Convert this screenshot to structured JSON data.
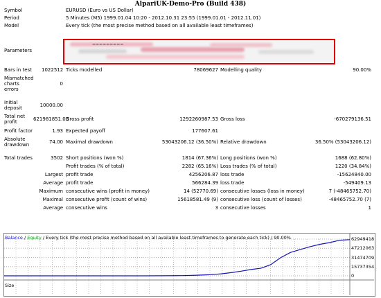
{
  "window": {
    "title": "AlpariUK-Demo-Pro (Build 438)"
  },
  "report": {
    "symbol": {
      "label": "Symbol",
      "value": "EURUSD (Euro vs US Dollar)"
    },
    "period": {
      "label": "Period",
      "value": "5 Minutes (M5) 1999.01.04 10:20 - 2012.10.31 23:55 (1999.01.01 - 2012.11.01)"
    },
    "model": {
      "label": "Model",
      "value": "Every tick (the most precise method based on all available least timeframes)"
    },
    "parameters": {
      "label": "Parameters",
      "fragment": "========="
    },
    "bars": {
      "label": "Bars in test",
      "value": "1022512"
    },
    "ticks": {
      "label": "Ticks modelled",
      "value": "78069627"
    },
    "quality": {
      "label": "Modelling quality",
      "value": "90.00%"
    },
    "mismatched": {
      "label": [
        "Mismatched",
        "charts",
        "errors"
      ],
      "value": "0"
    },
    "deposit": {
      "label": [
        "Initial",
        "deposit"
      ],
      "value": "10000.00"
    },
    "net_profit": {
      "label": [
        "Total net",
        "profit"
      ],
      "value": "621981851.03"
    },
    "gross_profit": {
      "label": "Gross profit",
      "value": "1292260987.53"
    },
    "gross_loss": {
      "label": "Gross loss",
      "value": "-670279136.51"
    },
    "profit_factor": {
      "label": "Profit factor",
      "value": "1.93"
    },
    "expected_payoff": {
      "label": "Expected payoff",
      "value": "177607.61"
    },
    "abs_drawdown": {
      "label": [
        "Absolute",
        "drawdown"
      ],
      "value": "74.00"
    },
    "max_drawdown": {
      "label": "Maximal drawdown",
      "value": "53043206.12 (36.50%)"
    },
    "rel_drawdown": {
      "label": "Relative drawdown",
      "value": "36.50% (53043206.12)"
    },
    "total_trades": {
      "label": "Total trades",
      "value": "3502"
    },
    "short_positions": {
      "label": "Short positions (won %)",
      "value": "1814 (67.36%)"
    },
    "long_positions": {
      "label": "Long positions (won %)",
      "value": "1688 (62.80%)"
    },
    "profit_trades": {
      "label": "Profit trades (% of total)",
      "value": "2282 (65.16%)"
    },
    "loss_trades": {
      "label": "Loss trades (% of total)",
      "value": "1220 (34.84%)"
    },
    "largest": {
      "prefix": "Largest",
      "profit_label": "profit trade",
      "profit_value": "4256206.87",
      "loss_label": "loss trade",
      "loss_value": "-15624840.00"
    },
    "average": {
      "prefix": "Average",
      "profit_label": "profit trade",
      "profit_value": "566284.39",
      "loss_label": "loss trade",
      "loss_value": "-549409.13"
    },
    "maximum": {
      "prefix": "Maximum",
      "wins_label": "consecutive wins (profit in money)",
      "wins_value": "14 (52770.69)",
      "losses_label": "consecutive losses (loss in money)",
      "losses_value": "7 (-48465752.70)"
    },
    "maximal": {
      "prefix": "Maximal",
      "profit_label": "consecutive profit (count of wins)",
      "profit_value": "15618581.49 (9)",
      "loss_label": "consecutive loss (count of losses)",
      "loss_value": "-48465752.70 (7)"
    },
    "avg_consec": {
      "prefix": "Average",
      "wins_label": "consecutive wins",
      "wins_value": "3",
      "losses_label": "consecutive losses",
      "losses_value": "1"
    }
  },
  "chart": {
    "legend_balance": "Balance",
    "legend_sep": " / ",
    "legend_equity": "Equity",
    "legend_rest": " / Every tick (the most precise method based on all available least timeframes to generate each tick) / 90.00%",
    "size_label": "Size",
    "colors": {
      "balance": "#1414b4",
      "equity": "#1e9628",
      "frame": "#7f7f7f"
    }
  },
  "chart_data": {
    "type": "line",
    "title": "",
    "ylim": [
      0,
      62949418
    ],
    "yticks": [
      "62949418",
      "47212063",
      "31474709",
      "15737354",
      "0"
    ],
    "grid": true,
    "series": [
      {
        "name": "Balance",
        "x": [
          0,
          200,
          400,
          600,
          800,
          1000,
          1200,
          1400,
          1600,
          1800,
          1900,
          2000,
          2100,
          2200,
          2300,
          2400,
          2500,
          2600,
          2700,
          2800,
          2900,
          3000,
          3100,
          3200,
          3300,
          3400,
          3502
        ],
        "values": [
          10000,
          10000,
          10000,
          10000,
          10000,
          10000,
          20000,
          50000,
          100000,
          300000,
          700000,
          1300000,
          2000000,
          3500000,
          5500000,
          8000000,
          10800000,
          13000000,
          19000000,
          31000000,
          40000000,
          45000000,
          50000000,
          54000000,
          57000000,
          61000000,
          62000000
        ]
      }
    ]
  }
}
